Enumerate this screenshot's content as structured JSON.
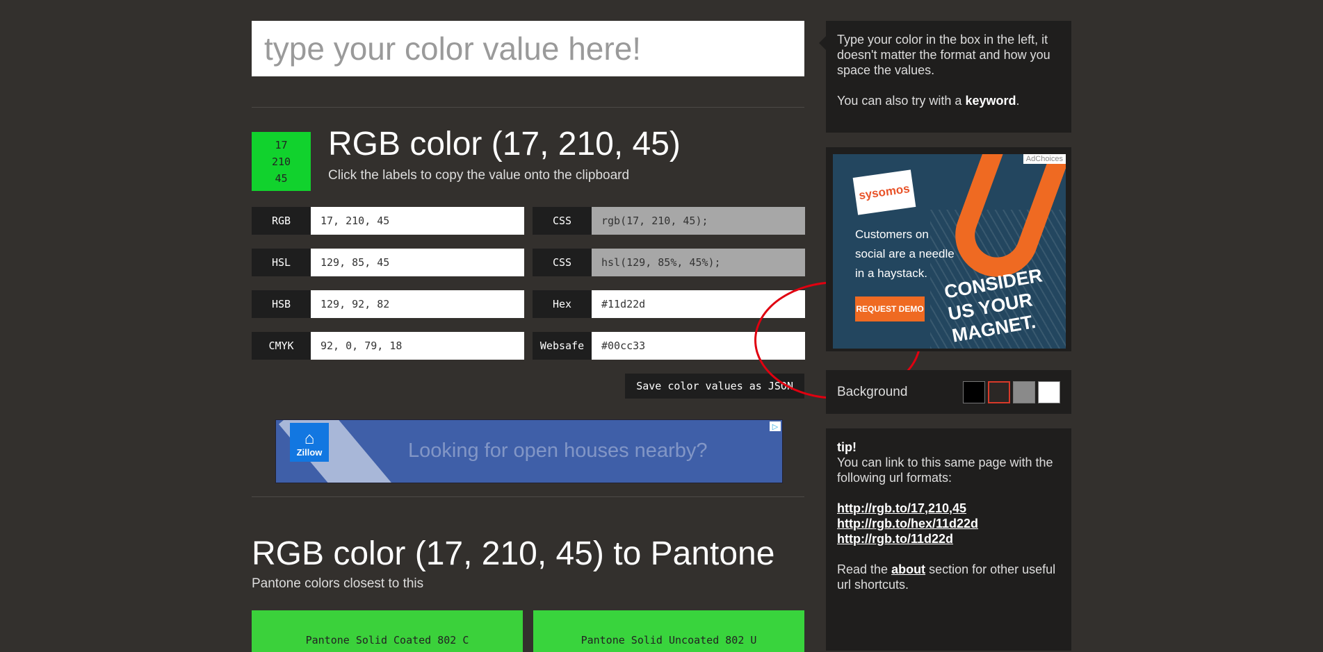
{
  "input": {
    "placeholder": "type your color value here!"
  },
  "swatch": {
    "color": "#11d22d",
    "r": "17",
    "g": "210",
    "b": "45"
  },
  "header": {
    "title": "RGB color (17, 210, 45)",
    "subtitle": "Click the labels to copy the value onto the clipboard"
  },
  "values": [
    {
      "label": "RGB",
      "value": "17, 210, 45"
    },
    {
      "label": "HSL",
      "value": "129, 85, 45"
    },
    {
      "label": "HSB",
      "value": "129, 92, 82"
    },
    {
      "label": "CMYK",
      "value": "92, 0, 79, 18"
    },
    {
      "label": "CSS",
      "value": "rgb(17, 210, 45);"
    },
    {
      "label": "CSS",
      "value": "hsl(129, 85%, 45%);"
    },
    {
      "label": "Hex",
      "value": "#11d22d"
    },
    {
      "label": "Websafe",
      "value": "#00cc33"
    }
  ],
  "json_button": "Save color values as JSON",
  "banner_ad": {
    "brand": "Zillow",
    "headline": "Looking for open houses nearby?"
  },
  "pantone": {
    "title": "RGB color (17, 210, 45) to Pantone",
    "subtitle": "Pantone colors closest to this",
    "cards": [
      {
        "name": "Pantone Solid Coated 802 C",
        "color": "#3bd13b"
      },
      {
        "name": "Pantone Solid Uncoated 802 U",
        "color": "#39d43d"
      }
    ]
  },
  "sidebar": {
    "info_text": "Type your color in the box in the left, it doesn't matter the format and how you space the values.",
    "info_keyword_pre": "You can also try with a ",
    "info_keyword": "keyword",
    "info_keyword_post": ".",
    "ad": {
      "choices": "AdChoices",
      "brand": "sysomos",
      "copy": "Customers on social are a needle in a haystack.",
      "cta": "REQUEST DEMO",
      "tagline_1": "CONSIDER",
      "tagline_2": "US YOUR",
      "tagline_3": "MAGNET."
    },
    "background": {
      "label": "Background",
      "swatches": [
        "#000000",
        "#2b2725",
        "#8a8a8a",
        "#ffffff"
      ],
      "selected_border": "#d83a2a"
    },
    "tip": {
      "head": "tip!",
      "text": "You can link to this same page with the following url formats:",
      "links": [
        "http://rgb.to/17,210,45",
        "http://rgb.to/hex/11d22d",
        "http://rgb.to/11d22d"
      ],
      "read_pre": "Read the ",
      "read_link": "about",
      "read_post": " section for other useful url shortcuts."
    }
  }
}
